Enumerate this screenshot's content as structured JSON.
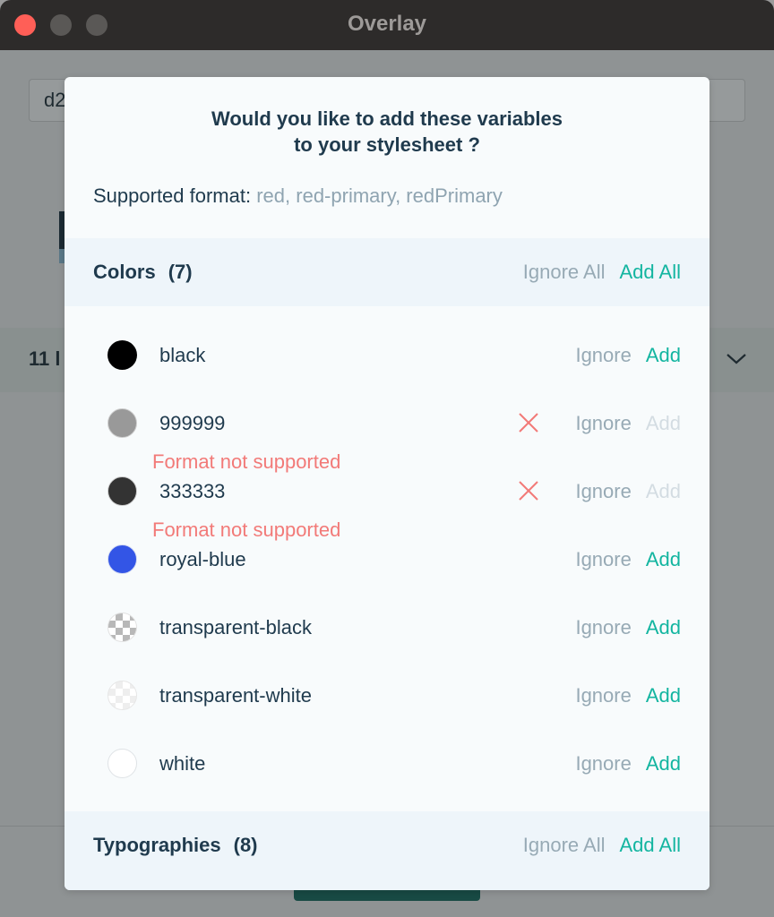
{
  "window": {
    "title": "Overlay"
  },
  "background": {
    "input_value": "d2",
    "layers_count": "11 l"
  },
  "modal": {
    "title_line1": "Would you like to add these variables",
    "title_line2": "to your stylesheet ?",
    "supported_label": "Supported format:",
    "supported_formats": "red, red-primary, redPrimary",
    "colors_section": {
      "title": "Colors",
      "count": "(7)",
      "ignore_all": "Ignore All",
      "add_all": "Add All"
    },
    "colors": [
      {
        "name": "black",
        "swatch": "#000000",
        "ignore": "Ignore",
        "add": "Add"
      },
      {
        "name": "999999",
        "swatch": "#999999",
        "ignore": "Ignore",
        "add": "Add",
        "error": "Format not supported"
      },
      {
        "name": "333333",
        "swatch": "#333333",
        "ignore": "Ignore",
        "add": "Add",
        "error": "Format not supported"
      },
      {
        "name": "royal-blue",
        "swatch": "#3355e6",
        "ignore": "Ignore",
        "add": "Add"
      },
      {
        "name": "transparent-black",
        "swatch": "#b8b8b8",
        "ignore": "Ignore",
        "add": "Add"
      },
      {
        "name": "transparent-white",
        "swatch": "#eeeeee",
        "ignore": "Ignore",
        "add": "Add"
      },
      {
        "name": "white",
        "swatch": "#ffffff",
        "ignore": "Ignore",
        "add": "Add"
      }
    ],
    "typographies_section": {
      "title": "Typographies",
      "count": "(8)",
      "ignore_all": "Ignore All",
      "add_all": "Add All"
    }
  },
  "colors_theme": {
    "accent": "#13b5a0",
    "error": "#f27a78",
    "muted": "#97aab5",
    "text": "#1f3a4d"
  }
}
